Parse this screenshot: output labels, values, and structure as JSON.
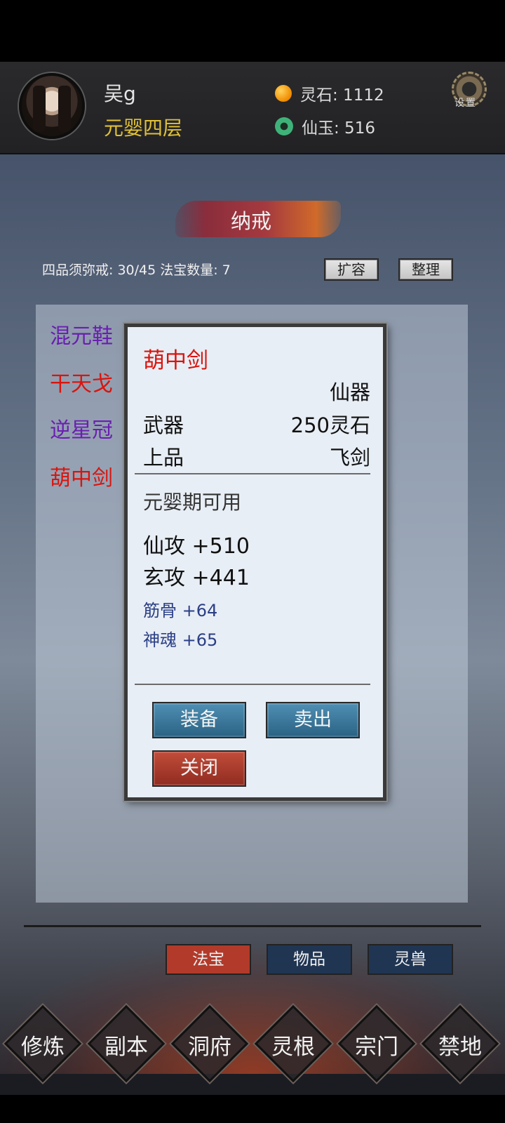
{
  "player": {
    "name": "吴g",
    "realm": "元婴四层"
  },
  "currency": {
    "spirit_stone_label": "灵石: 1112",
    "immortal_jade_label": "仙玉: 516"
  },
  "settings": {
    "label": "设置"
  },
  "storage": {
    "title": "纳戒",
    "stats": "四品须弥戒: 30/45  法宝数量: 7",
    "expand_label": "扩容",
    "sort_label": "整理"
  },
  "items": [
    {
      "name": "混元鞋",
      "color": "#6a1fb0"
    },
    {
      "name": "干天戈",
      "color": "#d9150e"
    },
    {
      "name": "逆星冠",
      "color": "#6a1fb0"
    },
    {
      "name": "葫中剑",
      "color": "#d9150e"
    }
  ],
  "detail": {
    "title": "葫中剑",
    "grade": "仙器",
    "type": "武器",
    "price": "250灵石",
    "quality": "上品",
    "category": "飞剑",
    "requirement": "元婴期可用",
    "attrs": [
      "仙攻 +510",
      "玄攻 +441"
    ],
    "sub_attrs": [
      "筋骨 +64",
      "神魂 +65"
    ],
    "equip_label": "装备",
    "sell_label": "卖出",
    "close_label": "关闭"
  },
  "tabs": [
    {
      "label": "法宝",
      "active": true
    },
    {
      "label": "物品",
      "active": false
    },
    {
      "label": "灵兽",
      "active": false
    }
  ],
  "nav": [
    "修炼",
    "副本",
    "洞府",
    "灵根",
    "宗门",
    "禁地"
  ]
}
